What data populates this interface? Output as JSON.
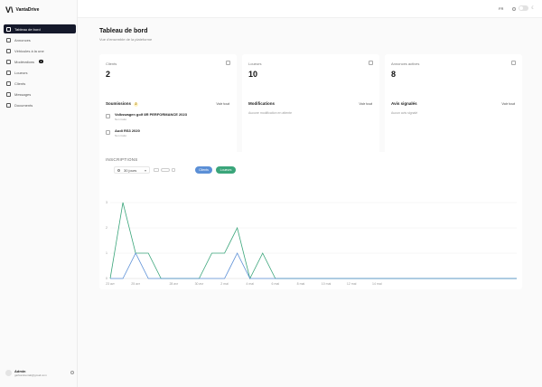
{
  "brand": {
    "logo": "V\\",
    "name": "VantaDrive"
  },
  "nav": [
    {
      "label": "Tableau de bord",
      "active": true,
      "badge": ""
    },
    {
      "label": "Annonces",
      "badge": ""
    },
    {
      "label": "Véhicules à la une",
      "badge": ""
    },
    {
      "label": "Modérations",
      "badge": "3"
    },
    {
      "label": "Loueurs",
      "badge": ""
    },
    {
      "label": "Clients",
      "badge": ""
    },
    {
      "label": "Messages",
      "badge": ""
    },
    {
      "label": "Documents",
      "badge": ""
    }
  ],
  "user": {
    "name": "Admin",
    "email": "gaifcardrentalt@gmail.com"
  },
  "topbar": {
    "lang": "FR"
  },
  "header": {
    "title": "Tableau de bord",
    "subtitle": "Vue d'ensemble de la plateforme"
  },
  "stats": [
    {
      "label": "Clients",
      "value": "2"
    },
    {
      "label": "Loueurs",
      "value": "10"
    },
    {
      "label": "Annonces actives",
      "value": "8"
    }
  ],
  "submissions": {
    "title": "Soumissions",
    "count": "2",
    "link": "Voir tout",
    "items": [
      {
        "title": "Volkswagen golf 8R PERFORMANCE 2023",
        "status": "Non traité"
      },
      {
        "title": "Audi RS3 2020",
        "status": "Non traité"
      }
    ]
  },
  "modifications": {
    "title": "Modifications",
    "link": "Voir tout",
    "empty": "Aucune modification en attente"
  },
  "reports": {
    "title": "Avis signalés",
    "link": "Voir tout",
    "empty": "Aucun avis signalé"
  },
  "chart_panel": {
    "title": "INSCRIPTIONS",
    "period": "30 jours",
    "pill_clients": "Clients",
    "pill_loueurs": "Loueurs"
  },
  "chart_data": {
    "type": "line",
    "x": [
      "23 avr",
      "24 avr",
      "25 avr",
      "26 avr",
      "27 avr",
      "28 avr",
      "29 avr",
      "30 avr",
      "1 mai",
      "2 mai",
      "3 mai",
      "4 mai",
      "5 mai",
      "6 mai",
      "7 mai",
      "8 mai",
      "9 mai",
      "10 mai",
      "11 mai",
      "12 mai",
      "13 mai",
      "14 mai",
      "15 mai",
      "16 mai",
      "17 mai",
      "18 mai",
      "19 mai",
      "20 mai",
      "21 mai",
      "22 mai",
      "23 mai",
      "24 mai",
      "25 mai"
    ],
    "tick_labels": [
      "23 avr",
      "25 avr",
      "28 avr",
      "30 avr",
      "2 mai",
      "4 mai",
      "6 mai",
      "8 mai",
      "10 mai",
      "12 mai",
      "14 mai"
    ],
    "ylim": [
      0,
      3
    ],
    "yticks": [
      0,
      1,
      2,
      3
    ],
    "series": [
      {
        "color": "#3aa57a",
        "values": [
          0,
          3,
          1,
          1,
          0,
          0,
          0,
          0,
          1,
          1,
          2,
          0,
          1,
          0,
          0,
          0,
          0,
          0,
          0,
          0,
          0,
          0,
          0,
          0,
          0,
          0,
          0,
          0,
          0,
          0,
          0,
          0,
          0
        ]
      },
      {
        "color": "#5b8fd6",
        "values": [
          0,
          0,
          1,
          0,
          0,
          0,
          0,
          0,
          0,
          0,
          1,
          0,
          0,
          0,
          0,
          0,
          0,
          0,
          0,
          0,
          0,
          0,
          0,
          0,
          0,
          0,
          0,
          0,
          0,
          0,
          0,
          0,
          0
        ]
      }
    ]
  }
}
